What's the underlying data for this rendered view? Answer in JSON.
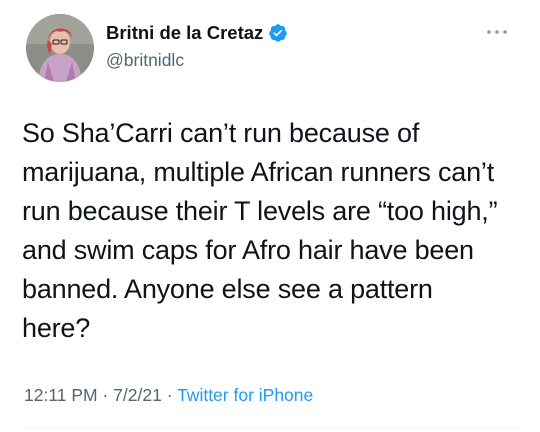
{
  "tweet": {
    "author": {
      "display_name": "Britni de la Cretaz",
      "handle": "@britnidlc",
      "verified": true,
      "avatar_icon": "profile-photo"
    },
    "text_lines": [
      "So Sha’Carri can’t run because of",
      "marijuana, multiple African runners can’t",
      "run because their T levels are “too high,”",
      "and swim caps for Afro hair have been",
      "banned. Anyone else see a pattern",
      "here?"
    ],
    "time": "12:11 PM",
    "separator": " · ",
    "date": "7/2/21",
    "source": "Twitter for iPhone"
  },
  "colors": {
    "text": "#0f1419",
    "secondary": "#536471",
    "accent": "#1d9bf0",
    "divider": "#eff3f4"
  },
  "icons": {
    "verified": "verified-badge-icon",
    "more": "more-options-icon"
  }
}
